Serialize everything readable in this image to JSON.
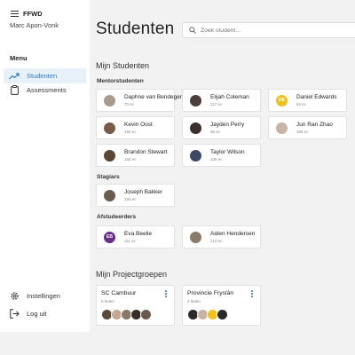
{
  "app": {
    "brand": "FFWD",
    "user_name": "Marc Apon-Vonk"
  },
  "sidebar": {
    "menu_label": "Menu",
    "items": [
      {
        "label": "Studenten",
        "icon": "trending-up-icon",
        "active": true
      },
      {
        "label": "Assessments",
        "icon": "clipboard-icon",
        "active": false
      }
    ],
    "footer_items": [
      {
        "label": "Instellingen",
        "icon": "gear-icon"
      },
      {
        "label": "Log uit",
        "icon": "logout-icon"
      }
    ]
  },
  "header": {
    "title": "Studenten",
    "search_placeholder": "Zoek student..."
  },
  "students": {
    "title": "Mijn Studenten",
    "mentor_label": "Mentorstudenten",
    "mentor": [
      {
        "name": "Daphne van Bendegem",
        "ec": "70 ec",
        "avatar_color": "#a89a8c"
      },
      {
        "name": "Elijah Coleman",
        "ec": "117 ec",
        "avatar_color": "#4a3f3a"
      },
      {
        "name": "Daniel Edwards",
        "ec": "93 ec",
        "avatar_color": "#f1c21b",
        "initials": "DE"
      },
      {
        "name": "Kevin Oost",
        "ec": "150 ec",
        "avatar_color": "#7b5a4a"
      },
      {
        "name": "Jayden Perry",
        "ec": "96 ec",
        "avatar_color": "#3b2f2b"
      },
      {
        "name": "Jun Ran Zhao",
        "ec": "186 ec",
        "avatar_color": "#c9b3a4"
      },
      {
        "name": "Brandon Stewart",
        "ec": "150 ec",
        "avatar_color": "#5a4636"
      },
      {
        "name": "Taylor Wilson",
        "ec": "106 ec",
        "avatar_color": "#3d4a63"
      }
    ],
    "intern_label": "Stagiars",
    "interns": [
      {
        "name": "Joseph Bakker",
        "ec": "159 ec",
        "avatar_color": "#6b5b4d"
      }
    ],
    "graduate_label": "Afstudeerders",
    "graduates": [
      {
        "name": "Eva Beelie",
        "ec": "111 ec",
        "avatar_color": "#6b2d8a",
        "initials": "EB"
      },
      {
        "name": "Aiden Hendersen",
        "ec": "210 ec",
        "avatar_color": "#8a7a6a"
      }
    ]
  },
  "projects": {
    "title": "Mijn Projectgroepen",
    "groups": [
      {
        "name": "SC Cambuur",
        "count": "5 leden",
        "member_colors": [
          "#5a4a3a",
          "#c4a890",
          "#8a7868",
          "#3a2e28",
          "#6a5a4a"
        ]
      },
      {
        "name": "Provincie Fryslân",
        "count": "4 leden",
        "member_colors": [
          "#2e2a2a",
          "#c9b3a4",
          "#f1c21b",
          "#2a2a2a"
        ]
      }
    ]
  }
}
